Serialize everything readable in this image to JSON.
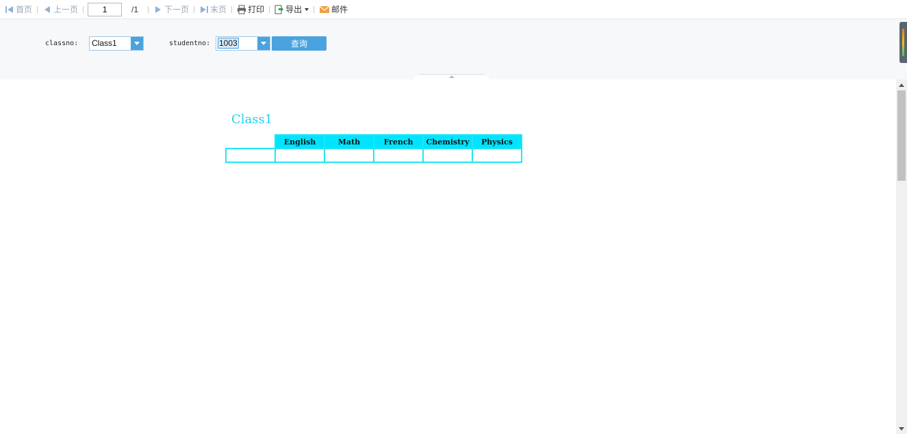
{
  "toolbar": {
    "first": "首页",
    "prev": "上一页",
    "page_value": "1",
    "page_total": "/1",
    "next": "下一页",
    "last": "末页",
    "print": "打印",
    "export": "导出",
    "mail": "邮件"
  },
  "params": {
    "classno_label": "classno:",
    "classno_value": "Class1",
    "studentno_label": "studentno:",
    "studentno_value": "1003",
    "query_button": "查询"
  },
  "report": {
    "title": "Class1",
    "columns": [
      "English",
      "Math",
      "French",
      "Chemistry",
      "Physics"
    ]
  },
  "colors": {
    "accent": "#4aa3df",
    "report_cyan": "#00e5ff",
    "title_cyan": "#1fd0f0",
    "disabled_text": "#9aa8b8"
  },
  "icons": {
    "first": "first-page-icon",
    "prev": "prev-page-icon",
    "next": "next-page-icon",
    "last": "last-page-icon",
    "print": "printer-icon",
    "export": "export-icon",
    "mail": "mail-icon"
  }
}
